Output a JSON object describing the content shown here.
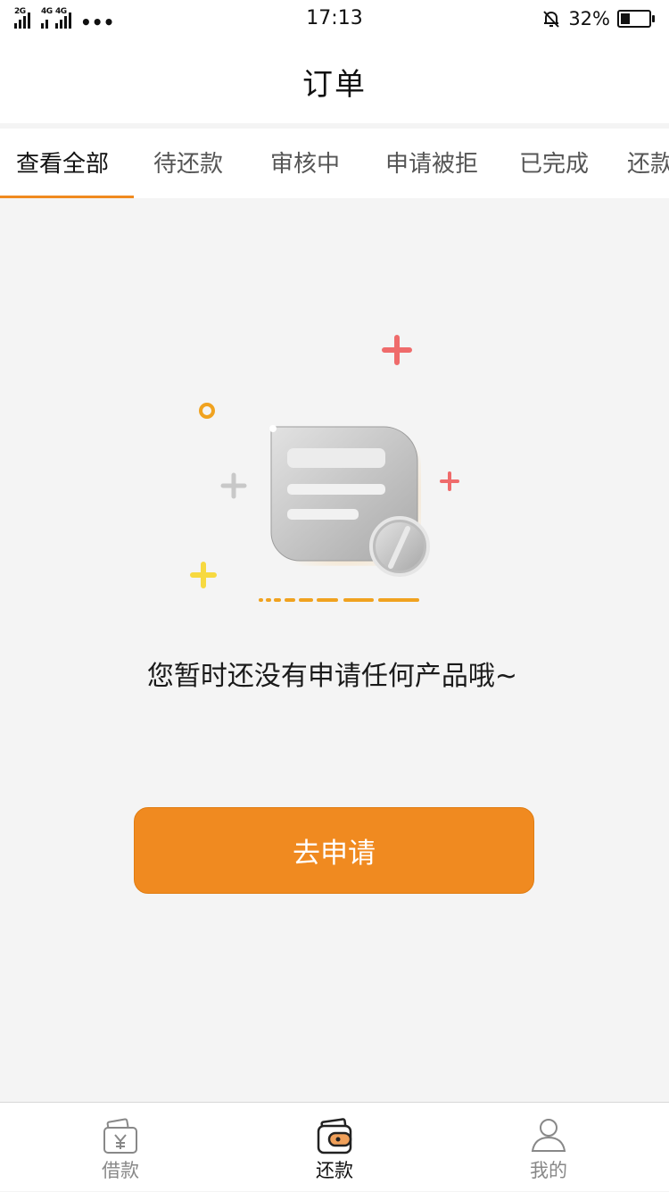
{
  "status_bar": {
    "network_1": "2G",
    "network_2": "4G",
    "network_3": "4G",
    "more": "•••",
    "time": "17:13",
    "battery_percent": "32%",
    "battery_level": 0.32,
    "icons": [
      "signal-icon",
      "signal-icon",
      "more-dots-icon",
      "bell-muted-icon",
      "battery-icon"
    ]
  },
  "header": {
    "title": "订单"
  },
  "tabs": [
    {
      "label": "查看全部",
      "active": true
    },
    {
      "label": "待还款"
    },
    {
      "label": "审核中"
    },
    {
      "label": "申请被拒"
    },
    {
      "label": "已完成"
    },
    {
      "label": "还款"
    }
  ],
  "empty_state": {
    "illustration": "empty-document-icon",
    "message": "您暂时还没有申请任何产品哦~",
    "button_label": "去申请"
  },
  "bottom_nav": [
    {
      "label": "借款",
      "icon": "wallet-yen-icon"
    },
    {
      "label": "还款",
      "icon": "wallet-icon",
      "active": true
    },
    {
      "label": "我的",
      "icon": "user-icon"
    }
  ],
  "colors": {
    "accent": "#f08a20",
    "background": "#f4f4f4",
    "plus_red": "#ef6b6b",
    "plus_yellow": "#f7d940",
    "plus_gray": "#c8c8c8"
  }
}
